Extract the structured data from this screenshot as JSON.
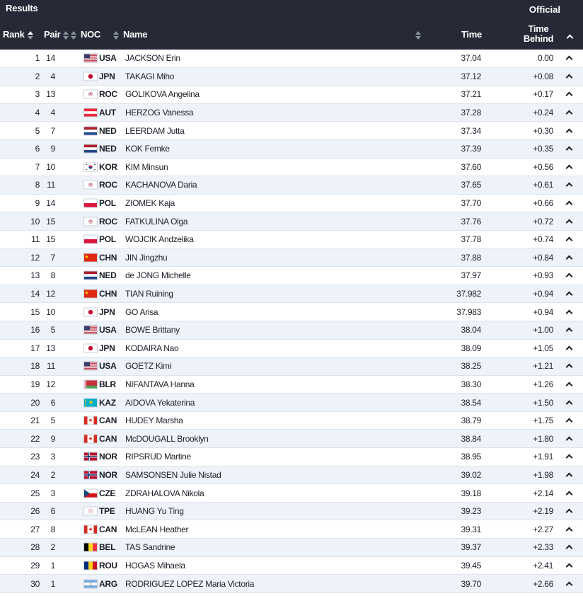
{
  "header": {
    "title": "Results",
    "official": "Official",
    "columns": {
      "rank": "Rank",
      "pair": "Pair",
      "noc": "NOC",
      "name": "Name",
      "time": "Time",
      "behind_1": "Time",
      "behind_2": "Behind"
    }
  },
  "colors": {
    "header_bg": "#252a36",
    "row_alt_bg": "#eef3fa"
  },
  "rows": [
    {
      "rank": "1",
      "pair": "14",
      "noc": "USA",
      "name": "JACKSON Erin",
      "time": "37.04",
      "behind": "0.00",
      "flag": "usa-flag-icon"
    },
    {
      "rank": "2",
      "pair": "4",
      "noc": "JPN",
      "name": "TAKAGI Miho",
      "time": "37.12",
      "behind": "+0.08",
      "flag": "jpn-flag-icon"
    },
    {
      "rank": "3",
      "pair": "13",
      "noc": "ROC",
      "name": "GOLIKOVA Angelina",
      "time": "37.21",
      "behind": "+0.17",
      "flag": "roc-flag-icon"
    },
    {
      "rank": "4",
      "pair": "4",
      "noc": "AUT",
      "name": "HERZOG Vanessa",
      "time": "37.28",
      "behind": "+0.24",
      "flag": "aut-flag-icon"
    },
    {
      "rank": "5",
      "pair": "7",
      "noc": "NED",
      "name": "LEERDAM Jutta",
      "time": "37.34",
      "behind": "+0.30",
      "flag": "ned-flag-icon"
    },
    {
      "rank": "6",
      "pair": "9",
      "noc": "NED",
      "name": "KOK Femke",
      "time": "37.39",
      "behind": "+0.35",
      "flag": "ned-flag-icon"
    },
    {
      "rank": "7",
      "pair": "10",
      "noc": "KOR",
      "name": "KIM Minsun",
      "time": "37.60",
      "behind": "+0.56",
      "flag": "kor-flag-icon"
    },
    {
      "rank": "8",
      "pair": "11",
      "noc": "ROC",
      "name": "KACHANOVA Daria",
      "time": "37.65",
      "behind": "+0.61",
      "flag": "roc-flag-icon"
    },
    {
      "rank": "9",
      "pair": "14",
      "noc": "POL",
      "name": "ZIOMEK Kaja",
      "time": "37.70",
      "behind": "+0.66",
      "flag": "pol-flag-icon"
    },
    {
      "rank": "10",
      "pair": "15",
      "noc": "ROC",
      "name": "FATKULINA Olga",
      "time": "37.76",
      "behind": "+0.72",
      "flag": "roc-flag-icon"
    },
    {
      "rank": "11",
      "pair": "15",
      "noc": "POL",
      "name": "WOJCIK Andzelika",
      "time": "37.78",
      "behind": "+0.74",
      "flag": "pol-flag-icon"
    },
    {
      "rank": "12",
      "pair": "7",
      "noc": "CHN",
      "name": "JIN Jingzhu",
      "time": "37.88",
      "behind": "+0.84",
      "flag": "chn-flag-icon"
    },
    {
      "rank": "13",
      "pair": "8",
      "noc": "NED",
      "name": "de JONG Michelle",
      "time": "37.97",
      "behind": "+0.93",
      "flag": "ned-flag-icon"
    },
    {
      "rank": "14",
      "pair": "12",
      "noc": "CHN",
      "name": "TIAN Ruining",
      "time": "37.982",
      "behind": "+0.94",
      "flag": "chn-flag-icon"
    },
    {
      "rank": "15",
      "pair": "10",
      "noc": "JPN",
      "name": "GO Arisa",
      "time": "37.983",
      "behind": "+0.94",
      "flag": "jpn-flag-icon"
    },
    {
      "rank": "16",
      "pair": "5",
      "noc": "USA",
      "name": "BOWE Brittany",
      "time": "38.04",
      "behind": "+1.00",
      "flag": "usa-flag-icon"
    },
    {
      "rank": "17",
      "pair": "13",
      "noc": "JPN",
      "name": "KODAIRA Nao",
      "time": "38.09",
      "behind": "+1.05",
      "flag": "jpn-flag-icon"
    },
    {
      "rank": "18",
      "pair": "11",
      "noc": "USA",
      "name": "GOETZ Kimi",
      "time": "38.25",
      "behind": "+1.21",
      "flag": "usa-flag-icon"
    },
    {
      "rank": "19",
      "pair": "12",
      "noc": "BLR",
      "name": "NIFANTAVA Hanna",
      "time": "38.30",
      "behind": "+1.26",
      "flag": "blr-flag-icon"
    },
    {
      "rank": "20",
      "pair": "6",
      "noc": "KAZ",
      "name": "AIDOVA Yekaterina",
      "time": "38.54",
      "behind": "+1.50",
      "flag": "kaz-flag-icon"
    },
    {
      "rank": "21",
      "pair": "5",
      "noc": "CAN",
      "name": "HUDEY Marsha",
      "time": "38.79",
      "behind": "+1.75",
      "flag": "can-flag-icon"
    },
    {
      "rank": "22",
      "pair": "9",
      "noc": "CAN",
      "name": "McDOUGALL Brooklyn",
      "time": "38.84",
      "behind": "+1.80",
      "flag": "can-flag-icon"
    },
    {
      "rank": "23",
      "pair": "3",
      "noc": "NOR",
      "name": "RIPSRUD Martine",
      "time": "38.95",
      "behind": "+1.91",
      "flag": "nor-flag-icon"
    },
    {
      "rank": "24",
      "pair": "2",
      "noc": "NOR",
      "name": "SAMSONSEN Julie Nistad",
      "time": "39.02",
      "behind": "+1.98",
      "flag": "nor-flag-icon"
    },
    {
      "rank": "25",
      "pair": "3",
      "noc": "CZE",
      "name": "ZDRAHALOVA Nikola",
      "time": "39.18",
      "behind": "+2.14",
      "flag": "cze-flag-icon"
    },
    {
      "rank": "26",
      "pair": "6",
      "noc": "TPE",
      "name": "HUANG Yu Ting",
      "time": "39.23",
      "behind": "+2.19",
      "flag": "tpe-flag-icon"
    },
    {
      "rank": "27",
      "pair": "8",
      "noc": "CAN",
      "name": "McLEAN Heather",
      "time": "39.31",
      "behind": "+2.27",
      "flag": "can-flag-icon"
    },
    {
      "rank": "28",
      "pair": "2",
      "noc": "BEL",
      "name": "TAS Sandrine",
      "time": "39.37",
      "behind": "+2.33",
      "flag": "bel-flag-icon"
    },
    {
      "rank": "29",
      "pair": "1",
      "noc": "ROU",
      "name": "HOGAS Mihaela",
      "time": "39.45",
      "behind": "+2.41",
      "flag": "rou-flag-icon"
    },
    {
      "rank": "30",
      "pair": "1",
      "noc": "ARG",
      "name": "RODRIGUEZ LOPEZ Maria Victoria",
      "time": "39.70",
      "behind": "+2.66",
      "flag": "arg-flag-icon"
    }
  ]
}
